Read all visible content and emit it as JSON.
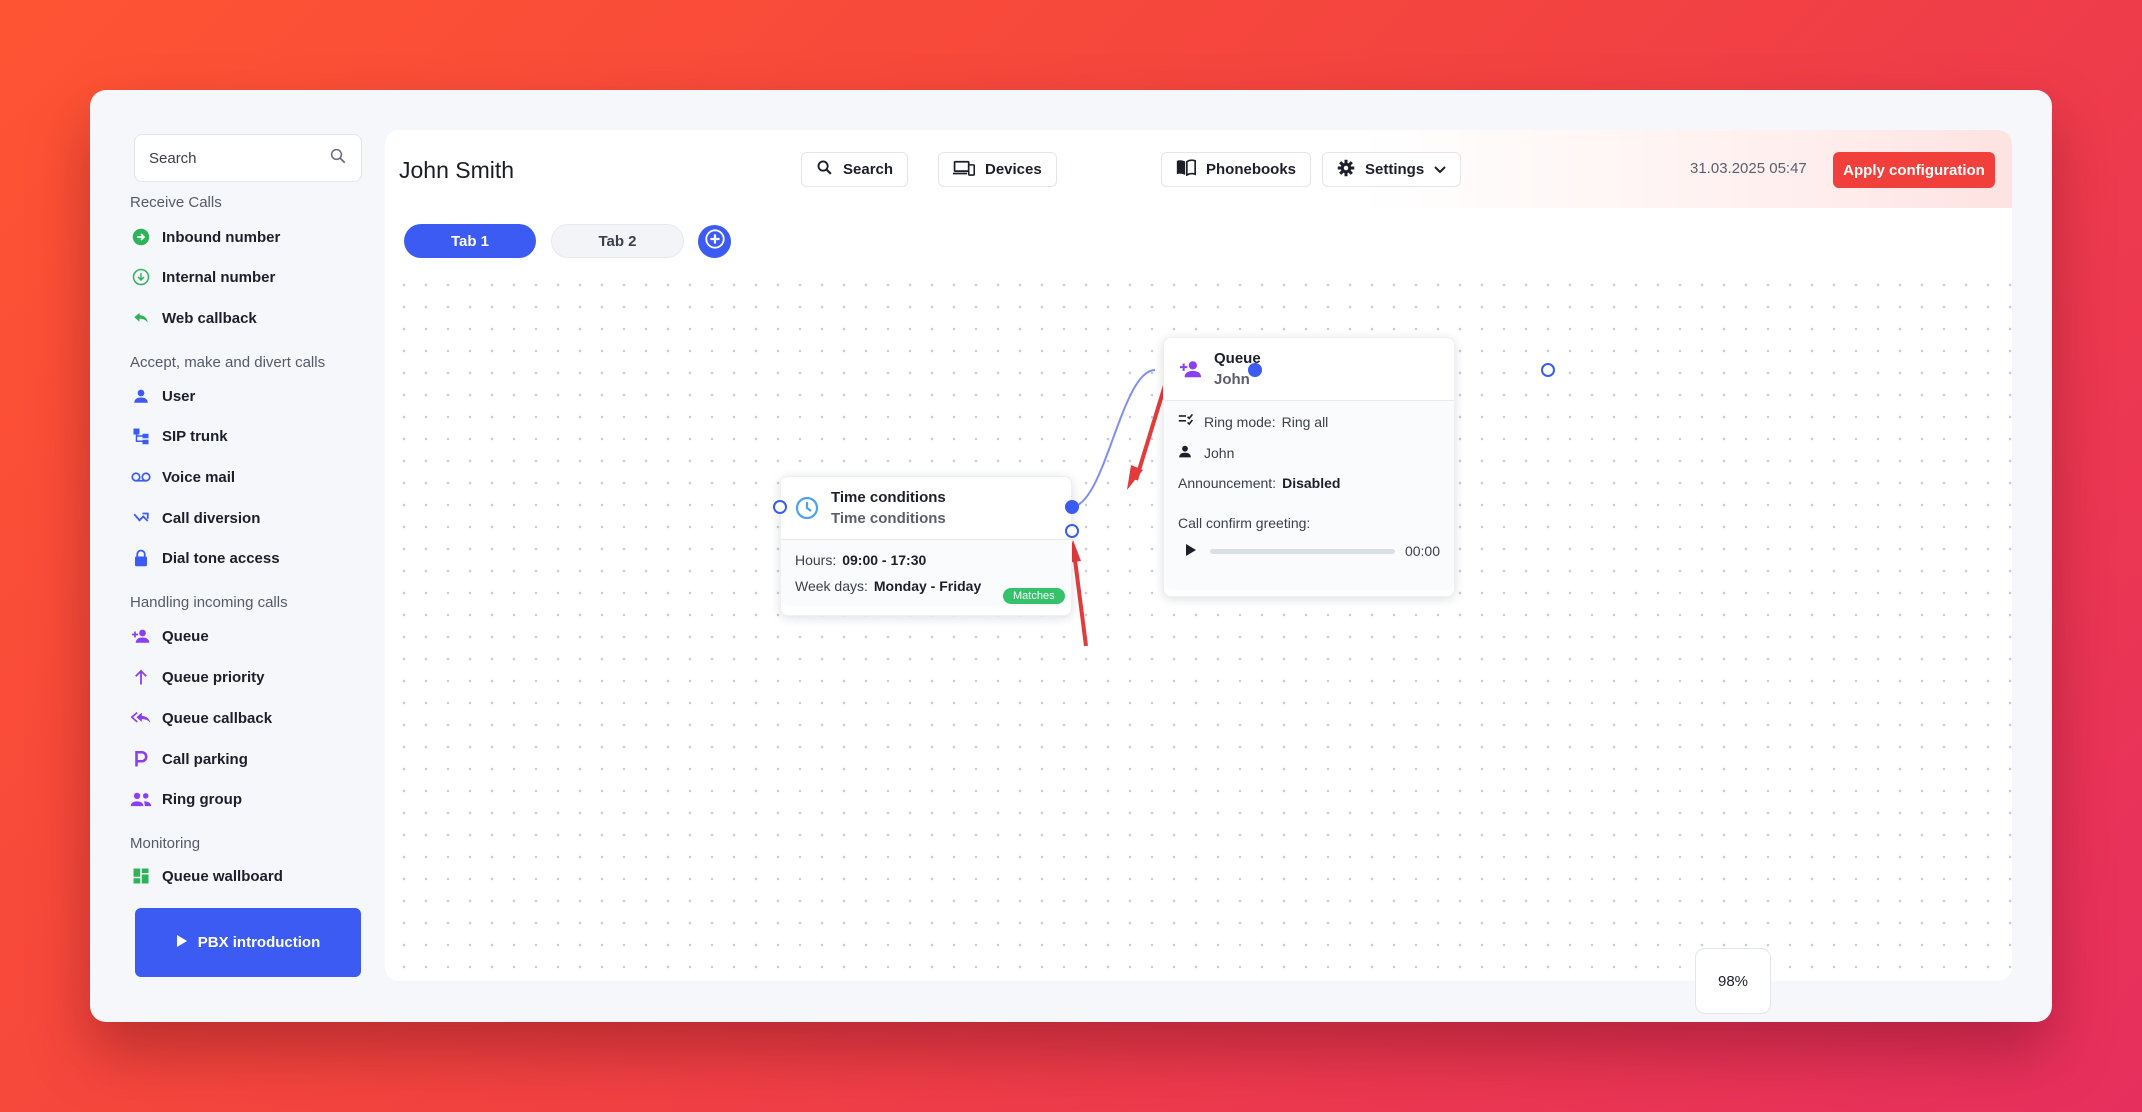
{
  "sidebar": {
    "search_label": "Search",
    "sections": [
      {
        "title": "Receive Calls",
        "items": [
          {
            "label": "Inbound number",
            "icon": "arrow-circle-in-icon"
          },
          {
            "label": "Internal number",
            "icon": "arrow-circle-down-icon"
          },
          {
            "label": "Web callback",
            "icon": "reply-icon"
          }
        ]
      },
      {
        "title": "Accept, make and divert calls",
        "items": [
          {
            "label": "User",
            "icon": "user-icon"
          },
          {
            "label": "SIP trunk",
            "icon": "sip-trunk-icon"
          },
          {
            "label": "Voice mail",
            "icon": "voicemail-icon"
          },
          {
            "label": "Call diversion",
            "icon": "divert-icon"
          },
          {
            "label": "Dial tone access",
            "icon": "lock-icon"
          }
        ]
      },
      {
        "title": "Handling incoming calls",
        "items": [
          {
            "label": "Queue",
            "icon": "user-add-icon"
          },
          {
            "label": "Queue priority",
            "icon": "arrow-up-icon"
          },
          {
            "label": "Queue callback",
            "icon": "reply-all-icon"
          },
          {
            "label": "Call parking",
            "icon": "parking-icon"
          },
          {
            "label": "Ring group",
            "icon": "group-icon"
          }
        ]
      },
      {
        "title": "Monitoring",
        "items": [
          {
            "label": "Queue wallboard",
            "icon": "dashboard-icon"
          }
        ]
      }
    ],
    "pbx_intro_label": "PBX introduction"
  },
  "header": {
    "title": "John Smith",
    "buttons": {
      "search": "Search",
      "devices": "Devices",
      "phonebooks": "Phonebooks",
      "settings": "Settings"
    },
    "datetime": "31.03.2025 05:47",
    "apply_label": "Apply configuration"
  },
  "tabs": [
    {
      "label": "Tab 1"
    },
    {
      "label": "Tab 2"
    }
  ],
  "nodes": {
    "time_conditions": {
      "title": "Time conditions",
      "subtitle": "Time conditions",
      "hours_label": "Hours:",
      "hours_value": "09:00 - 17:30",
      "weekdays_label": "Week days:",
      "weekdays_value": "Monday - Friday"
    },
    "queue": {
      "title": "Queue",
      "subtitle": "John",
      "ring_mode_label": "Ring mode:",
      "ring_mode_value": "Ring all",
      "member": "John",
      "announcement_label": "Announcement:",
      "announcement_value": "Disabled",
      "greeting_label": "Call confirm greeting:",
      "audio_time": "00:00"
    },
    "edge_label": "Matches"
  },
  "zoom": "98%",
  "colors": {
    "accent": "#3b5bf2",
    "apply": "#f1403c",
    "matches": "#34c26a",
    "annotation_arrow": "#e23b3b"
  }
}
